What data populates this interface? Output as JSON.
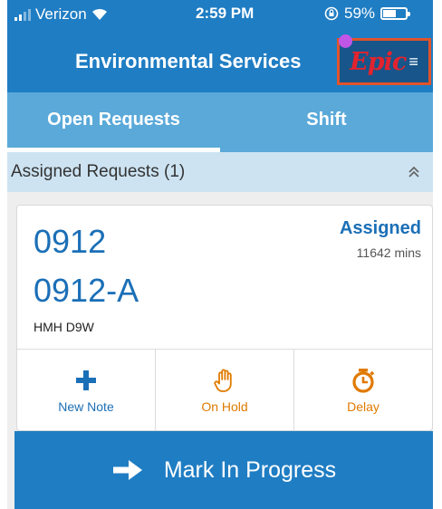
{
  "status_bar": {
    "carrier": "Verizon",
    "time": "2:59 PM",
    "battery": "59%",
    "battery_level": 0.59
  },
  "header": {
    "title": "Environmental Services",
    "logo_text": "Epic",
    "menu_glyph": "≡",
    "accent_color": "#1f7dc3",
    "logo_color": "#e2232e",
    "highlight_color": "#e0532b"
  },
  "tabs": [
    {
      "label": "Open Requests",
      "active": true
    },
    {
      "label": "Shift",
      "active": false
    }
  ],
  "section": {
    "title": "Assigned Requests (1)",
    "collapse_icon": "double-chevron-up-icon"
  },
  "request": {
    "room": "0912",
    "bed": "0912-A",
    "unit": "HMH D9W",
    "status": "Assigned",
    "elapsed": "11642 mins"
  },
  "actions": [
    {
      "label": "New Note",
      "icon": "plus-icon"
    },
    {
      "label": "On Hold",
      "icon": "hand-icon"
    },
    {
      "label": "Delay",
      "icon": "stopwatch-icon"
    }
  ],
  "primary_action": {
    "label": "Mark In Progress",
    "icon": "arrow-right-icon"
  }
}
